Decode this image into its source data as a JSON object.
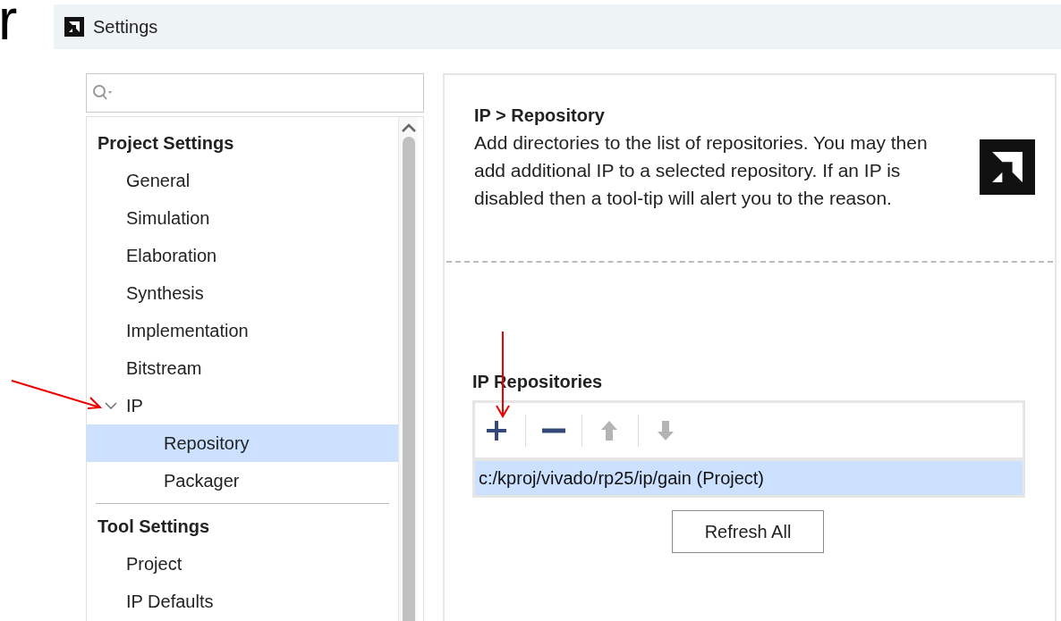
{
  "corner_text": "r",
  "window": {
    "title": "Settings"
  },
  "tree": [
    {
      "label": "Project Settings",
      "children": [
        {
          "label": "General",
          "selected": false
        },
        {
          "label": "Simulation",
          "selected": false
        },
        {
          "label": "Elaboration",
          "selected": false
        },
        {
          "label": "Synthesis",
          "selected": false
        },
        {
          "label": "Implementation",
          "selected": false
        },
        {
          "label": "Bitstream",
          "selected": false
        },
        {
          "label": "IP",
          "selected": false,
          "expanded": true,
          "children": [
            {
              "label": "Repository",
              "selected": true
            },
            {
              "label": "Packager",
              "selected": false
            }
          ]
        }
      ]
    },
    {
      "label": "Tool Settings",
      "children": [
        {
          "label": "Project",
          "selected": false
        },
        {
          "label": "IP Defaults",
          "selected": false
        }
      ]
    }
  ],
  "page": {
    "breadcrumb": "IP > Repository",
    "description": "Add directories to the list of repositories. You may then add additional IP to a selected repository. If an IP is disabled then a tool-tip will alert you to the reason.",
    "section_title": "IP Repositories",
    "toolbar": [
      {
        "kind": "add",
        "disabled": false
      },
      {
        "kind": "remove",
        "disabled": false
      },
      {
        "kind": "up",
        "disabled": true
      },
      {
        "kind": "down",
        "disabled": true
      }
    ],
    "repositories": [
      {
        "path": "c:/kproj/vivado/rp25/ip/gain (Project)",
        "selected": true
      }
    ],
    "refresh_button": "Refresh All"
  }
}
